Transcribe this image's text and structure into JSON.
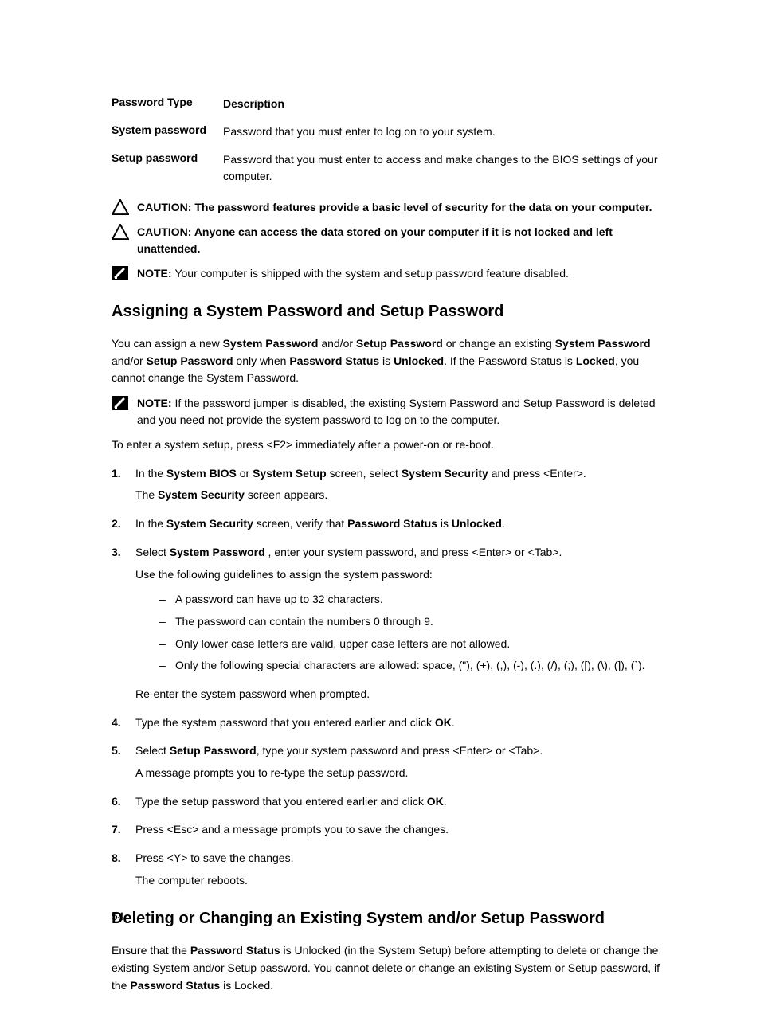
{
  "table": {
    "header": {
      "col1": "Password Type",
      "col2": "Description"
    },
    "rows": [
      {
        "col1": "System password",
        "col2": "Password that you must enter to log on to your system."
      },
      {
        "col1": "Setup password",
        "col2": "Password that you must enter to access and make changes to the BIOS settings of your computer."
      }
    ]
  },
  "caution1": {
    "label": "CAUTION: ",
    "text": "The password features provide a basic level of security for the data on your computer."
  },
  "caution2": {
    "label": "CAUTION: ",
    "text": "Anyone can access the data stored on your computer if it is not locked and left unattended."
  },
  "note1": {
    "label": "NOTE: ",
    "text": "Your computer is shipped with the system and setup password feature disabled."
  },
  "heading1": "Assigning a System Password and Setup Password",
  "intro": {
    "t1": "You can assign a new ",
    "b1": "System Password",
    "t2": " and/or ",
    "b2": "Setup Password",
    "t3": " or change an existing ",
    "b3": "System Password",
    "t4": " and/or ",
    "b4": "Setup Password",
    "t5": " only when ",
    "b5": "Password Status",
    "t6": " is ",
    "b6": "Unlocked",
    "t7": ". If the Password Status is ",
    "b7": "Locked",
    "t8": ", you cannot change the System Password."
  },
  "note2": {
    "label": "NOTE: ",
    "text": "If the password jumper is disabled, the existing System Password and Setup Password is deleted and you need not provide the system password to log on to the computer."
  },
  "enter_setup": "To enter a system setup, press <F2> immediately after a power-on or re-boot.",
  "steps": {
    "s1": {
      "num": "1.",
      "t1": "In the ",
      "b1": "System BIOS",
      "t2": " or ",
      "b2": "System Setup",
      "t3": " screen, select ",
      "b3": "System Security",
      "t4": " and press <Enter>.",
      "line2a": "The ",
      "line2b": "System Security",
      "line2c": " screen appears."
    },
    "s2": {
      "num": "2.",
      "t1": "In the ",
      "b1": "System Security",
      "t2": " screen, verify that ",
      "b2": "Password Status",
      "t3": " is ",
      "b3": "Unlocked",
      "t4": "."
    },
    "s3": {
      "num": "3.",
      "t1": "Select ",
      "b1": "System Password",
      "t2": " , enter your system password, and press <Enter> or <Tab>.",
      "line2": "Use the following guidelines to assign the system password:",
      "sub": [
        "A password can have up to 32 characters.",
        "The password can contain the numbers 0 through 9.",
        "Only lower case letters are valid, upper case letters are not allowed.",
        "Only the following special characters are allowed: space, (\"), (+), (,), (-), (.), (/), (;), ([), (\\), (]), (`)."
      ],
      "after": "Re-enter the system password when prompted."
    },
    "s4": {
      "num": "4.",
      "t1": "Type the system password that you entered earlier and click ",
      "b1": "OK",
      "t2": "."
    },
    "s5": {
      "num": "5.",
      "t1": "Select ",
      "b1": "Setup Password",
      "t2": ", type your system password and press <Enter> or <Tab>.",
      "line2": "A message prompts you to re-type the setup password."
    },
    "s6": {
      "num": "6.",
      "t1": "Type the setup password that you entered earlier and click ",
      "b1": "OK",
      "t2": "."
    },
    "s7": {
      "num": "7.",
      "t1": "Press <Esc> and a message prompts you to save the changes."
    },
    "s8": {
      "num": "8.",
      "t1": "Press <Y> to save the changes.",
      "line2": "The computer reboots."
    }
  },
  "heading2": "Deleting or Changing an Existing System and/or Setup Password",
  "outro": {
    "t1": "Ensure that the ",
    "b1": "Password Status",
    "t2": " is Unlocked (in the System Setup) before attempting to delete or change the existing System and/or Setup password. You cannot delete or change an existing System or Setup password, if the ",
    "b2": "Password Status",
    "t3": " is Locked."
  },
  "page_number": "54"
}
